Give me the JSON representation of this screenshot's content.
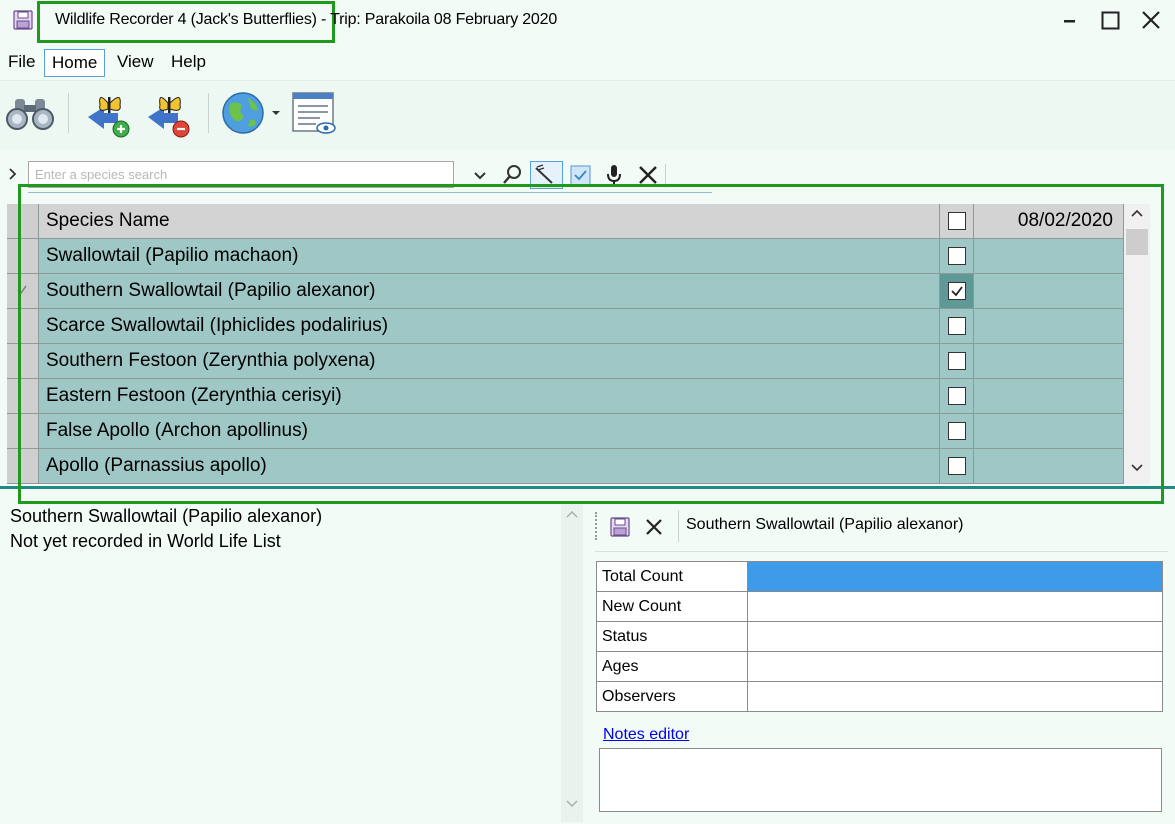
{
  "window": {
    "title": "Wildlife Recorder 4 (Jack's Butterflies) - Trip: Parakoila 08 February 2020"
  },
  "menu": {
    "items": [
      {
        "id": "file",
        "label": "File"
      },
      {
        "id": "home",
        "label": "Home",
        "selected": true
      },
      {
        "id": "view",
        "label": "View"
      },
      {
        "id": "help",
        "label": "Help"
      }
    ]
  },
  "toolbar": {
    "icons": [
      "binoculars-icon",
      "add-species-icon",
      "remove-species-icon",
      "globe-icon",
      "view-list-icon"
    ]
  },
  "search": {
    "placeholder": "Enter a species search",
    "value": ""
  },
  "grid": {
    "columns": {
      "name": "Species Name",
      "date": "08/02/2020"
    },
    "rows": [
      {
        "name": "Swallowtail (Papilio machaon)",
        "checked": false,
        "count": ""
      },
      {
        "name": "Southern Swallowtail (Papilio alexanor)",
        "checked": true,
        "count": "",
        "current": true
      },
      {
        "name": "Scarce Swallowtail (Iphiclides podalirius)",
        "checked": false,
        "count": ""
      },
      {
        "name": "Southern Festoon (Zerynthia polyxena)",
        "checked": false,
        "count": ""
      },
      {
        "name": "Eastern Festoon (Zerynthia cerisyi)",
        "checked": false,
        "count": ""
      },
      {
        "name": "False Apollo (Archon apollinus)",
        "checked": false,
        "count": ""
      },
      {
        "name": "Apollo (Parnassius apollo)",
        "checked": false,
        "count": ""
      }
    ]
  },
  "info": {
    "species": "Southern Swallowtail (Papilio alexanor)",
    "status": "Not yet recorded in World Life List"
  },
  "editor": {
    "title": "Southern Swallowtail (Papilio alexanor)",
    "fields": [
      {
        "label": "Total Count",
        "value": ""
      },
      {
        "label": "New Count",
        "value": ""
      },
      {
        "label": "Status",
        "value": ""
      },
      {
        "label": "Ages",
        "value": ""
      },
      {
        "label": "Observers",
        "value": ""
      }
    ],
    "notes_link": "Notes editor",
    "notes": ""
  },
  "colors": {
    "grid_row": "#9ec7c5",
    "grid_header": "#d3d3d3",
    "active_field": "#3d9be9",
    "highlight_box": "#1f9a1f",
    "splitter": "#1d8a86"
  }
}
